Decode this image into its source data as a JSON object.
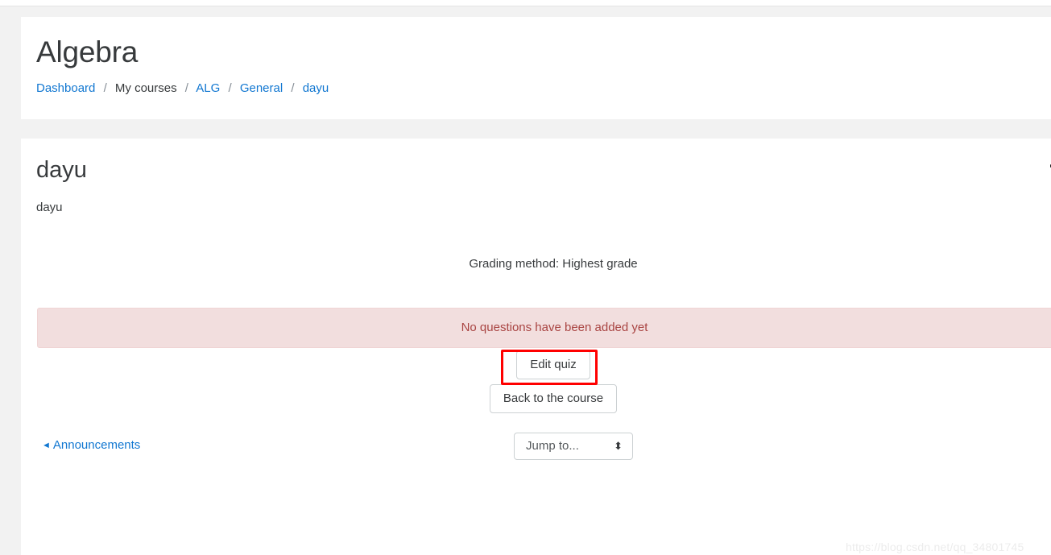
{
  "page": {
    "title": "Algebra"
  },
  "breadcrumb": {
    "separator": "/",
    "items": [
      {
        "label": "Dashboard",
        "link": true
      },
      {
        "label": "My courses",
        "link": false
      },
      {
        "label": "ALG",
        "link": true
      },
      {
        "label": "General",
        "link": true
      },
      {
        "label": "dayu",
        "link": true
      }
    ]
  },
  "activity": {
    "name": "dayu",
    "description": "dayu",
    "grading_method": "Grading method: Highest grade",
    "settings_icon": "gear-icon"
  },
  "alert": {
    "message": "No questions have been added yet",
    "close_label": "×",
    "background": "#f2dede",
    "text_color": "#a94442"
  },
  "buttons": {
    "edit_quiz": "Edit quiz",
    "back_to_course": "Back to the course"
  },
  "annotation": {
    "color": "#ff0000",
    "target": "Edit quiz"
  },
  "activity_nav": {
    "previous_arrow": "◄",
    "previous_label": "Announcements",
    "jump_to_value": "Jump to...",
    "jump_to_arrows": "⬍"
  },
  "watermark": {
    "text": "https://blog.csdn.net/qq_34801745"
  }
}
